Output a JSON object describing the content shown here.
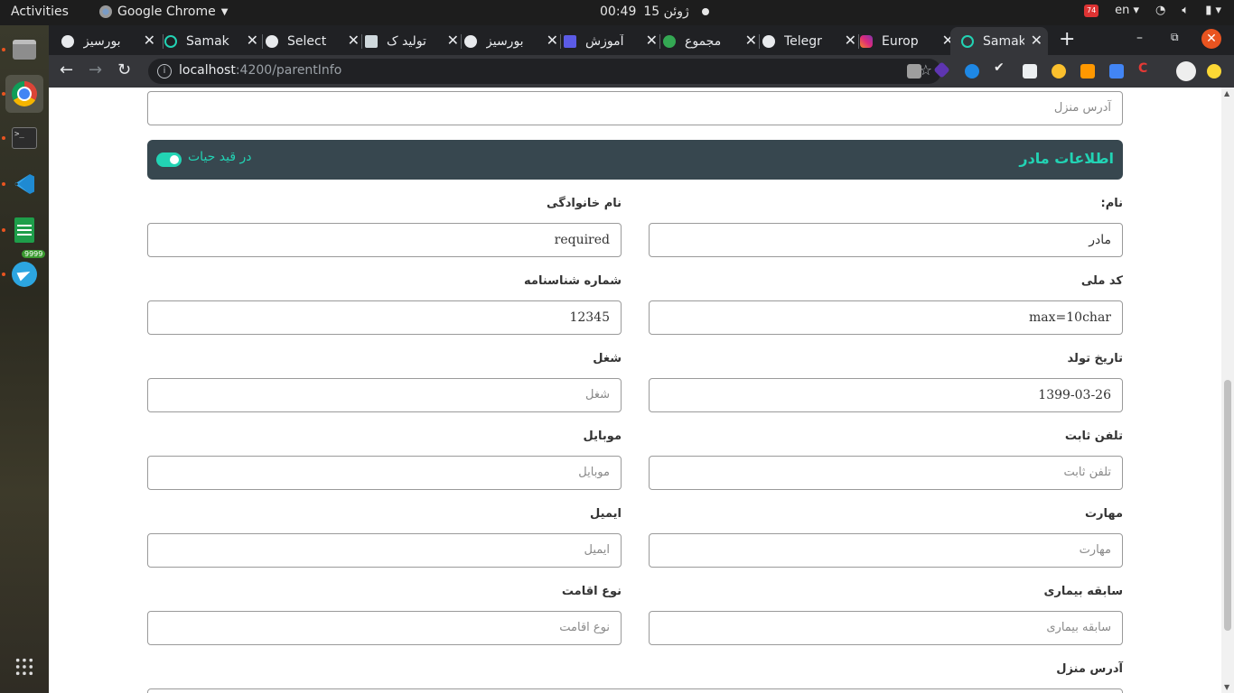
{
  "system_bar": {
    "activities": "Activities",
    "app_name": "Google Chrome",
    "clock_date": "ژوئن 15",
    "clock_time": "00:49",
    "battery_badge": "74",
    "keyboard_layout": "en"
  },
  "dock": {
    "telegram_badge": "9999"
  },
  "tabs": [
    {
      "label": "بورسیز",
      "active": false
    },
    {
      "label": "Samak",
      "active": false
    },
    {
      "label": "Select",
      "active": false
    },
    {
      "label": "تولید ک",
      "active": false
    },
    {
      "label": "بورسیز",
      "active": false
    },
    {
      "label": "آموزش",
      "active": false
    },
    {
      "label": "مجموع",
      "active": false
    },
    {
      "label": "Telegr",
      "active": false
    },
    {
      "label": "Europ",
      "active": false
    },
    {
      "label": "Samak",
      "active": true
    }
  ],
  "address_bar": {
    "host": "localhost",
    "path": ":4200/parentInfo"
  },
  "form": {
    "top_address_placeholder": "آدرس منزل",
    "mother_section": {
      "title": "اطلاعات مادر",
      "alive_label": "در قید حیات",
      "alive": true
    },
    "fields": {
      "first_name": {
        "label": "نام:",
        "value": "مادر"
      },
      "last_name": {
        "label": "نام خانوادگی",
        "value": "required"
      },
      "national_code": {
        "label": "کد ملی",
        "value": "max=10char"
      },
      "birth_cert_number": {
        "label": "شماره شناسنامه",
        "value": "12345"
      },
      "birth_date": {
        "label": "تاریخ تولد",
        "value": "1399-03-26"
      },
      "job": {
        "label": "شغل",
        "placeholder": "شغل"
      },
      "landline": {
        "label": "تلفن ثابت",
        "placeholder": "تلفن ثابت"
      },
      "mobile": {
        "label": "موبایل",
        "placeholder": "موبایل"
      },
      "skill": {
        "label": "مهارت",
        "placeholder": "مهارت"
      },
      "email": {
        "label": "ایمیل",
        "placeholder": "ایمیل"
      },
      "medical_history": {
        "label": "سابقه بیماری",
        "placeholder": "سابقه بیماری"
      },
      "residence_type": {
        "label": "نوع اقامت",
        "placeholder": "نوع اقامت"
      },
      "home_address": {
        "label": "آدرس منزل"
      }
    }
  },
  "colors": {
    "accent": "#22d3b4",
    "section_header_bg": "#37474f"
  }
}
